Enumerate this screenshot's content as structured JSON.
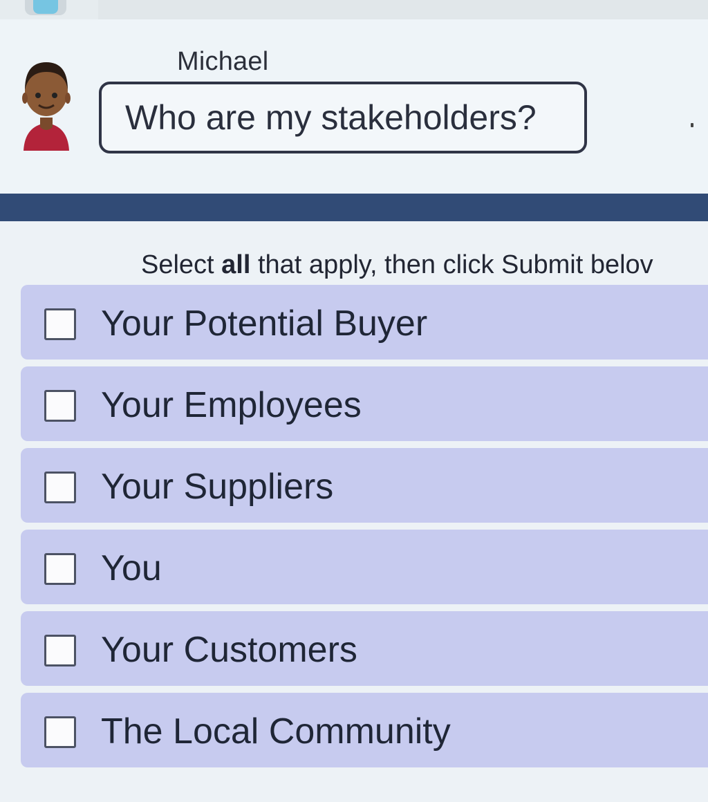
{
  "chat": {
    "speaker_name": "Michael",
    "message": "Who are my stakeholders?"
  },
  "instruction": {
    "prefix": "Select ",
    "emphasis": "all",
    "suffix": " that apply, then click Submit belov"
  },
  "options": [
    {
      "label": "Your Potential Buyer",
      "checked": false
    },
    {
      "label": "Your Employees",
      "checked": false
    },
    {
      "label": "Your Suppliers",
      "checked": false
    },
    {
      "label": "You",
      "checked": false
    },
    {
      "label": "Your Customers",
      "checked": false
    },
    {
      "label": "The Local Community",
      "checked": false
    }
  ],
  "colors": {
    "divider": "#314b76",
    "option_bg": "#c7cbef",
    "bubble_border": "#2f3446",
    "page_bg": "#eef4f8"
  },
  "icons": {
    "avatar": "person-avatar-icon",
    "checkbox": "checkbox-icon"
  }
}
